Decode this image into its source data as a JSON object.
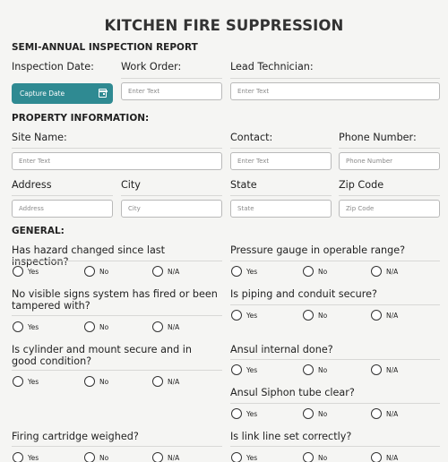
{
  "title": "KITCHEN FIRE SUPPRESSION",
  "subtitle": "SEMI-ANNUAL INSPECTION REPORT",
  "header": {
    "inspection_date_label": "Inspection Date:",
    "capture_date_label": "Capture Date",
    "work_order_label": "Work Order:",
    "work_order_placeholder": "Enter Text",
    "lead_technician_label": "Lead Technician:",
    "lead_technician_placeholder": "Enter Text"
  },
  "property": {
    "heading": "PROPERTY INFORMATION:",
    "site_name_label": "Site Name:",
    "site_name_placeholder": "Enter Text",
    "contact_label": "Contact:",
    "contact_placeholder": "Enter Text",
    "phone_label": "Phone Number:",
    "phone_placeholder": "Phone Number",
    "address_label": "Address",
    "address_placeholder": "Address",
    "city_label": "City",
    "city_placeholder": "City",
    "state_label": "State",
    "state_placeholder": "State",
    "zip_label": "Zip Code",
    "zip_placeholder": "Zip Code"
  },
  "general": {
    "heading": "GENERAL:",
    "options": [
      "Yes",
      "No",
      "N/A"
    ],
    "questions": [
      "Has hazard changed since last inspection?",
      "No visible signs system has fired or been tampered with?",
      "Is cylinder and mount secure and in good condition?",
      "Firing cartridge weighed?",
      "Pressure gauge in operable range?",
      "Is piping and conduit secure?",
      "Ansul internal done?",
      "Ansul Siphon tube clear?",
      "Is link line set correctly?"
    ]
  },
  "colors": {
    "accent": "#2f8a92",
    "background": "#f5f5f3"
  }
}
